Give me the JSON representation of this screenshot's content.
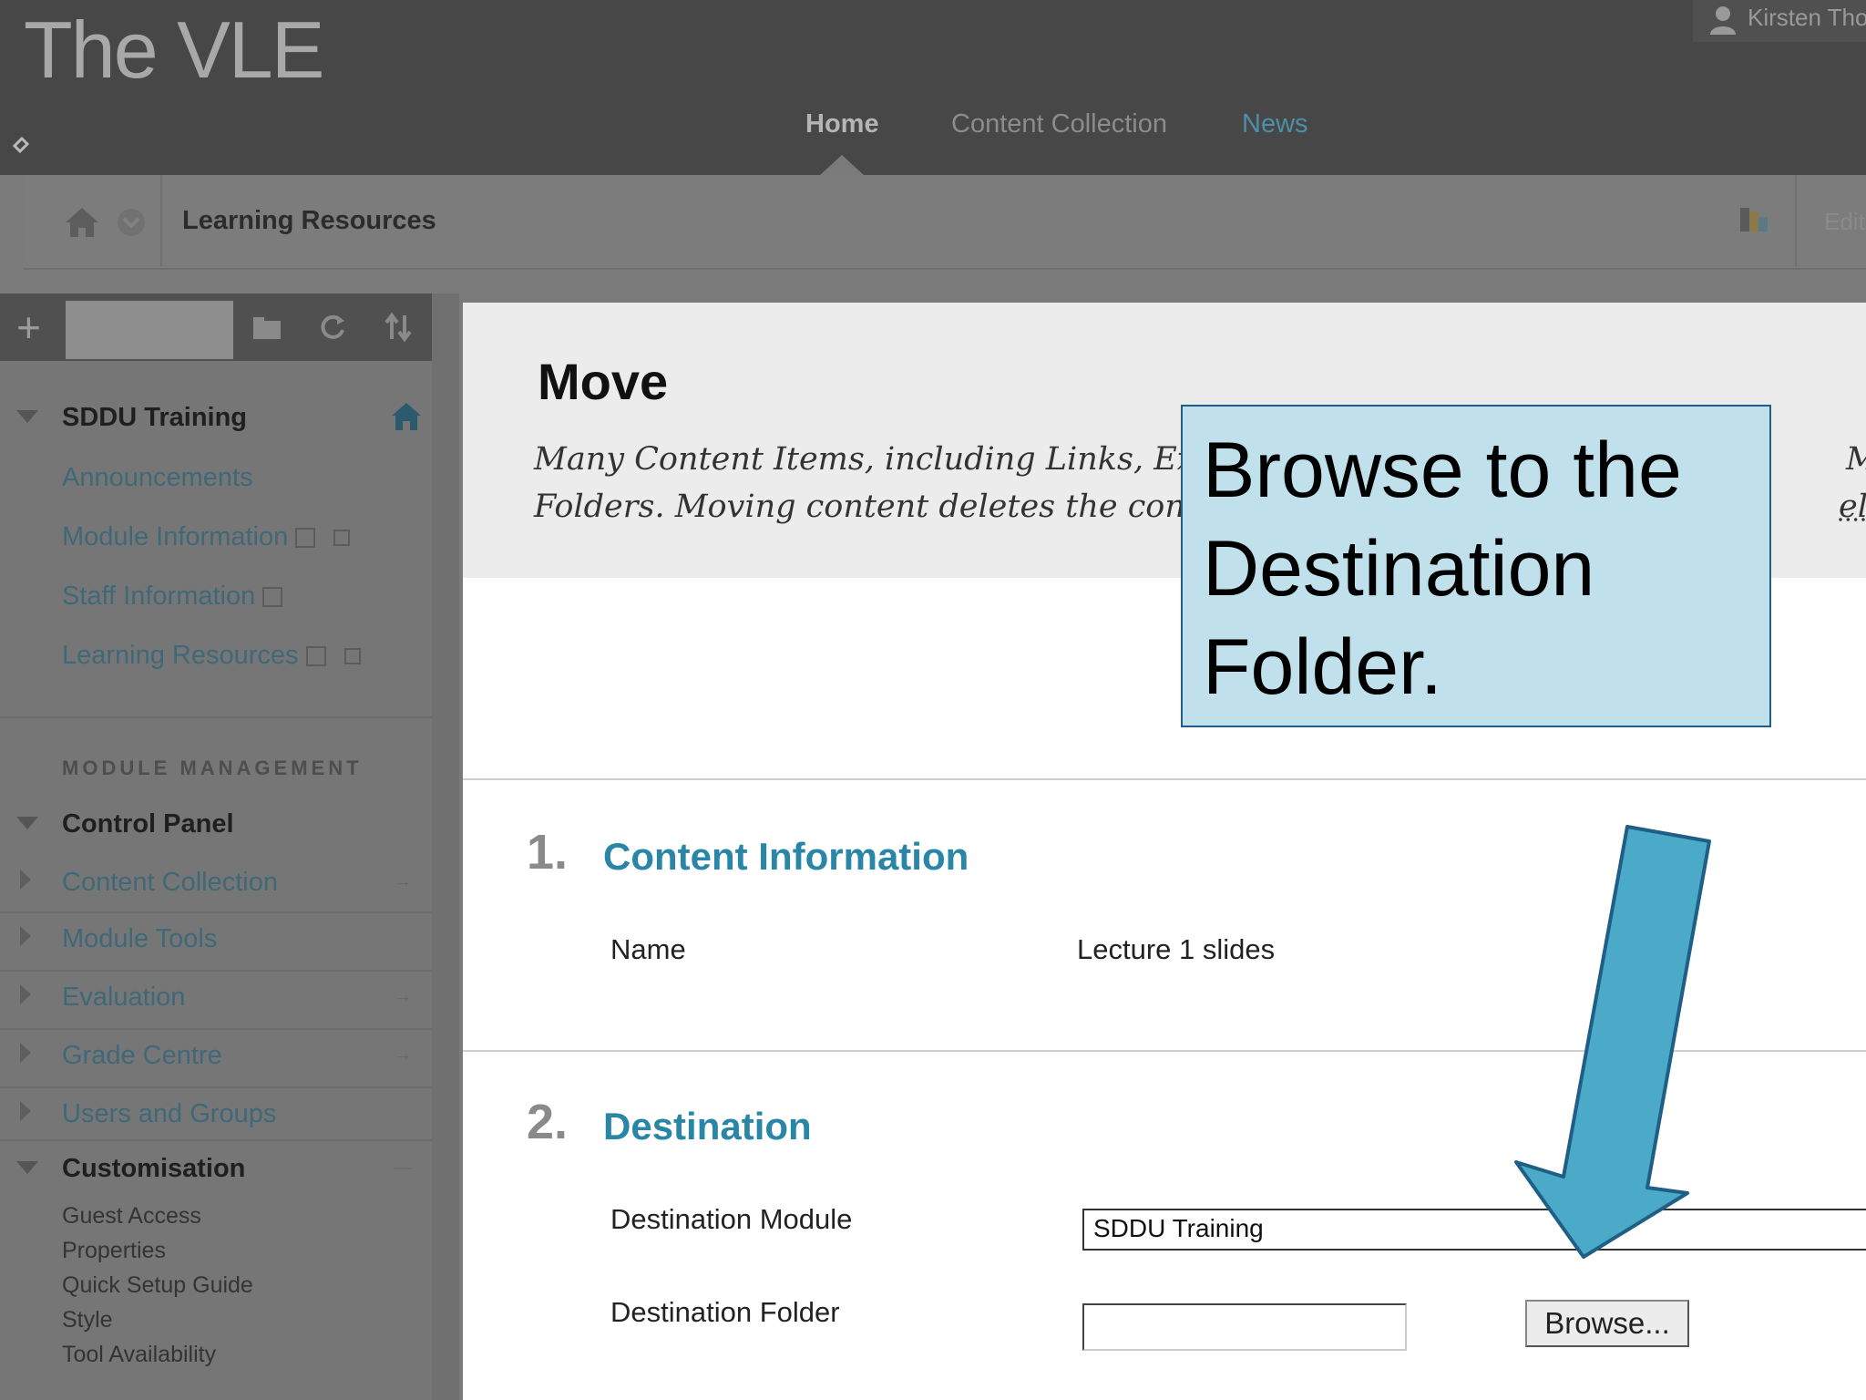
{
  "header": {
    "brand": "The VLE",
    "user_name": "Kirsten Tho",
    "nav": {
      "home": "Home",
      "content_collection": "Content Collection",
      "news": "News"
    }
  },
  "breadcrumb": {
    "current": "Learning Resources",
    "edit_label": "Edit"
  },
  "sidebar": {
    "course_title": "SDDU Training",
    "items": [
      {
        "label": "Announcements"
      },
      {
        "label": "Module Information"
      },
      {
        "label": "Staff Information"
      },
      {
        "label": "Learning Resources"
      }
    ],
    "management_heading": "MODULE MANAGEMENT",
    "control_panel": "Control Panel",
    "control_items": [
      {
        "label": "Content Collection"
      },
      {
        "label": "Module Tools"
      },
      {
        "label": "Evaluation"
      },
      {
        "label": "Grade Centre"
      },
      {
        "label": "Users and Groups"
      }
    ],
    "customisation": "Customisation",
    "customisation_items": [
      {
        "label": "Guest Access"
      },
      {
        "label": "Properties"
      },
      {
        "label": "Quick Setup Guide"
      },
      {
        "label": "Style"
      },
      {
        "label": "Tool Availability"
      }
    ]
  },
  "page": {
    "title": "Move",
    "description_line1": "Many Content Items, including Links, Ext",
    "description_line1_tail": "Modu",
    "description_line2": "Folders. Moving content deletes the conte",
    "description_line2_tail": "elp"
  },
  "sections": {
    "content_info": {
      "number": "1.",
      "title": "Content Information",
      "name_label": "Name",
      "name_value": "Lecture 1 slides"
    },
    "destination": {
      "number": "2.",
      "title": "Destination",
      "module_label": "Destination Module",
      "module_value": "SDDU Training",
      "folder_label": "Destination Folder",
      "folder_value": "",
      "browse_label": "Browse..."
    }
  },
  "callout": {
    "text": "Browse to the Destination Folder."
  },
  "colors": {
    "accent": "#2a86a6",
    "callout_bg": "#c0e1ec",
    "arrow": "#4aaac8"
  }
}
